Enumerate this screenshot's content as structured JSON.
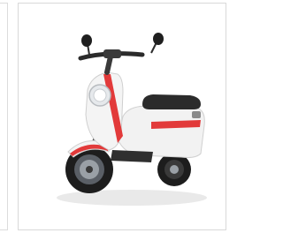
{
  "gallery": {
    "active_card": {
      "image": {
        "subject": "electric-scooter",
        "colors": {
          "body": "#f4f4f4",
          "stripe": "#e23a3a",
          "seat": "#2b2b2b",
          "tire": "#1d1d1d",
          "rim": "#9aa0a6"
        }
      }
    }
  }
}
